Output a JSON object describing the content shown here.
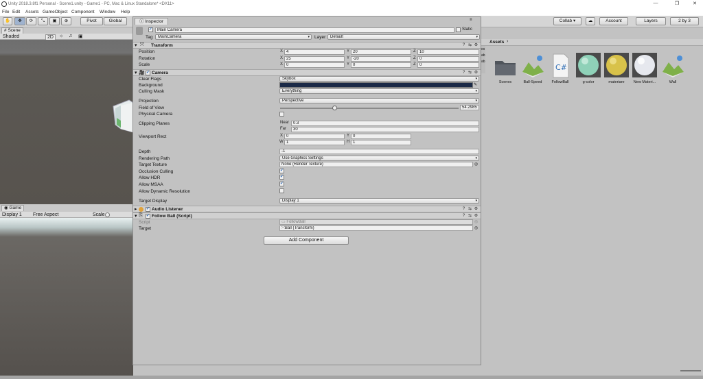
{
  "window": {
    "title": "Unity 2018.3.8f1 Personal - Scene1.unity - Game1 - PC, Mac & Linux Standalone* <DX11>",
    "controls": [
      "—",
      "❐",
      "✕"
    ]
  },
  "menu": [
    "File",
    "Edit",
    "Assets",
    "GameObject",
    "Component",
    "Window",
    "Help"
  ],
  "toolbar": {
    "pivot": "Pivot",
    "global": "Global",
    "collab": "Collab ▾",
    "cloud": "☁",
    "account": "Account",
    "layers": "Layers",
    "layout": "2 by 3"
  },
  "scene": {
    "tab": "Scene",
    "shading": "Shaded",
    "mode2d": "2D"
  },
  "game": {
    "tab": "Game",
    "display": "Display 1",
    "aspect": "Free Aspect",
    "scale_label": "Scale"
  },
  "inspector": {
    "tab": "Inspector",
    "object_name": "Main Camera",
    "static_label": "Static",
    "tag_label": "Tag",
    "tag_value": "MainCamera",
    "layer_label": "Layer",
    "layer_value": "Default",
    "transform": {
      "title": "Transform",
      "position_label": "Position",
      "rotation_label": "Rotation",
      "scale_label": "Scale",
      "position": {
        "x": "4",
        "y": "20",
        "z": "10"
      },
      "rotation": {
        "x": "25",
        "y": "-20",
        "z": "0"
      },
      "scale": {
        "x": "0",
        "y": "0",
        "z": "0"
      }
    },
    "camera": {
      "title": "Camera",
      "clear_flags_label": "Clear Flags",
      "clear_flags": "Skybox",
      "background_label": "Background",
      "background_color": "#1b2a47",
      "culling_mask_label": "Culling Mask",
      "culling_mask": "Everything",
      "projection_label": "Projection",
      "projection": "Perspective",
      "fov_label": "Field of View",
      "fov": "54.2985",
      "physical_label": "Physical Camera",
      "clipping_label": "Clipping Planes",
      "near_label": "Near",
      "near": "0.3",
      "far_label": "Far",
      "far": "30",
      "viewport_label": "Viewport Rect",
      "vp": {
        "x": "0",
        "y": "0",
        "w": "1",
        "h": "1"
      },
      "depth_label": "Depth",
      "depth": "-1",
      "rendering_label": "Rendering Path",
      "rendering": "Use Graphics Settings",
      "target_texture_label": "Target Texture",
      "target_texture": "None (Render Texture)",
      "occlusion_label": "Occlusion Culling",
      "hdr_label": "Allow HDR",
      "msaa_label": "Allow MSAA",
      "dynres_label": "Allow Dynamic Resolution",
      "target_display_label": "Target Display",
      "target_display": "Display 1"
    },
    "audio_listener": {
      "title": "Audio Listener"
    },
    "follow_ball": {
      "title": "Follow Ball (Script)",
      "script_label": "Script",
      "script_value": "FollowBall",
      "target_label": "Target",
      "target_value": "Ball (Transform)"
    },
    "add_component": "Add Component"
  },
  "assets": {
    "header": "Assets",
    "items": [
      {
        "name": "Scenes",
        "icon": "folder-icon",
        "color": "#5a5f66"
      },
      {
        "name": "Ball-Speed",
        "icon": "prefab-landscape-icon",
        "color": "#6fa04a"
      },
      {
        "name": "FollowBall",
        "icon": "csharp-script-icon",
        "color": "#2f6db5"
      },
      {
        "name": "g-color",
        "icon": "material-sphere-icon",
        "color": "#8fd1b8"
      },
      {
        "name": "materiare",
        "icon": "material-sphere-icon",
        "color": "#d8c24a"
      },
      {
        "name": "New Materi...",
        "icon": "material-sphere-icon",
        "color": "#e6e8ee"
      },
      {
        "name": "Wall",
        "icon": "prefab-landscape-icon",
        "color": "#6fa04a"
      }
    ]
  }
}
